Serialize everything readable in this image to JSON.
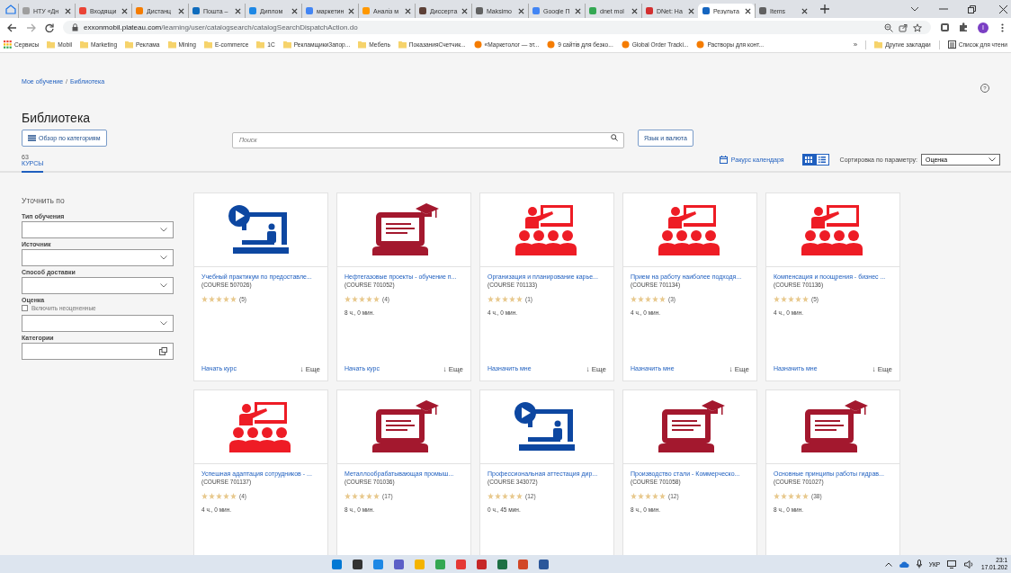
{
  "browser": {
    "tabs": [
      {
        "title": "НТУ «Дн",
        "color": "#9e9e9e",
        "selected": false
      },
      {
        "title": "Входящи",
        "color": "#ea4335",
        "selected": false
      },
      {
        "title": "Дистанц",
        "color": "#f57c00",
        "selected": false
      },
      {
        "title": "Пошта – ",
        "color": "#0f6cbd",
        "selected": false
      },
      {
        "title": "Диплом ",
        "color": "#1e88e5",
        "selected": false
      },
      {
        "title": "маркетин",
        "color": "#4285f4",
        "selected": false
      },
      {
        "title": "Аналіз м",
        "color": "#ff9800",
        "selected": false
      },
      {
        "title": "Диссерта",
        "color": "#5d4037",
        "selected": false
      },
      {
        "title": "Maksimo",
        "color": "#616161",
        "selected": false
      },
      {
        "title": "Google П",
        "color": "#4285f4",
        "selected": false
      },
      {
        "title": "dnet mol",
        "color": "#34a853",
        "selected": false
      },
      {
        "title": "DNet: На",
        "color": "#d32f2f",
        "selected": false
      },
      {
        "title": "Результа",
        "color": "#1565c0",
        "selected": true
      },
      {
        "title": "Items",
        "color": "#616161",
        "selected": false
      }
    ],
    "url_host": "exxonmobil.plateau.com",
    "url_path": "/learning/user/catalogsearch/catalogSearchDispatchAction.do",
    "profile": "I",
    "bookmarks": [
      {
        "label": "Сервисы",
        "kind": "apps"
      },
      {
        "label": "Mobil",
        "kind": "folder"
      },
      {
        "label": "Marketing",
        "kind": "folder"
      },
      {
        "label": "Реклама",
        "kind": "folder"
      },
      {
        "label": "Mining",
        "kind": "folder"
      },
      {
        "label": "E-commerce",
        "kind": "folder"
      },
      {
        "label": "1С",
        "kind": "folder"
      },
      {
        "label": "РекламщикиЗапор...",
        "kind": "folder"
      },
      {
        "label": "Мебель",
        "kind": "folder"
      },
      {
        "label": "ПоказанияСчетчик...",
        "kind": "folder"
      },
      {
        "label": "«Маркетолог — эт...",
        "kind": "site"
      },
      {
        "label": "9 сайтів для безко...",
        "kind": "site"
      },
      {
        "label": "Global Order Tracki...",
        "kind": "site"
      },
      {
        "label": "Растворы для конт...",
        "kind": "site"
      }
    ],
    "more": "»",
    "other": [
      {
        "label": "Другие закладки",
        "kind": "folder"
      },
      {
        "label": "Список для чтени",
        "kind": "list"
      }
    ]
  },
  "page": {
    "breadcrumb": [
      "Мое обучение",
      "Библиотека"
    ],
    "breadcrumb_separator": "/",
    "help": "?",
    "title": "Библиотека",
    "browse_button": "Обзор по категориям",
    "search": {
      "placeholder": "Поиск"
    },
    "language_button": "Язык и валюта",
    "tab": {
      "count": "63",
      "label": "КУРСЫ",
      "selected": true
    },
    "calendar_link": "Ракурс календаря",
    "views": [
      {
        "kind": "grid",
        "selected": true
      },
      {
        "kind": "list",
        "selected": false
      }
    ],
    "sort_label": "Сортировка по параметру:",
    "sort_value": "Оценка",
    "refine": "Уточнить по",
    "filters": [
      {
        "label": "Тип обучения",
        "kind": "select"
      },
      {
        "label": "Источник",
        "kind": "select"
      },
      {
        "label": "Способ доставки",
        "kind": "select"
      },
      {
        "label": "Оценка",
        "kind": "select",
        "checkbox": {
          "label": "Включить неоцененные",
          "checked": false
        }
      },
      {
        "label": "Категории",
        "kind": "picker"
      }
    ],
    "cards": [
      {
        "kind": "video",
        "title": "Учебный практикум по предоставле...",
        "code": "(COURSE 507026)",
        "stars": 5,
        "reviews": "(5)",
        "action": "Начать курс",
        "more": "↓ Еще"
      },
      {
        "kind": "laptop",
        "title": "Нефтегазовые проекты - обучение п...",
        "code": "(COURSE 701052)",
        "stars": 5,
        "reviews": "(4)",
        "duration": "8 ч., 0 мин.",
        "action": "Начать курс",
        "more": "↓ Еще"
      },
      {
        "kind": "teacher",
        "title": "Организация и планирование карье...",
        "code": "(COURSE 701133)",
        "stars": 5,
        "reviews": "(1)",
        "duration": "4 ч., 0 мин.",
        "action": "Назначить мне",
        "more": "↓ Еще"
      },
      {
        "kind": "teacher",
        "title": "Прием на работу наиболее подходя...",
        "code": "(COURSE 701134)",
        "stars": 5,
        "reviews": "(3)",
        "duration": "4 ч., 0 мин.",
        "action": "Назначить мне",
        "more": "↓ Еще"
      },
      {
        "kind": "teacher",
        "title": "Компенсация и поощрения - бизнес ...",
        "code": "(COURSE 701136)",
        "stars": 5,
        "reviews": "(5)",
        "duration": "4 ч., 0 мин.",
        "action": "Назначить мне",
        "more": "↓ Еще"
      },
      {
        "kind": "teacher",
        "title": "Успешная адаптация сотрудников - ...",
        "code": "(COURSE 701137)",
        "stars": 5,
        "reviews": "(4)",
        "duration": "4 ч., 0 мин."
      },
      {
        "kind": "laptop",
        "title": "Металлообрабатывающая промыш...",
        "code": "(COURSE 701036)",
        "stars": 5,
        "reviews": "(17)",
        "duration": "8 ч., 0 мин."
      },
      {
        "kind": "video",
        "title": "Профессиональная аттестация дир...",
        "code": "(COURSE 343072)",
        "stars": 5,
        "reviews": "(12)",
        "duration": "0 ч., 45 мин."
      },
      {
        "kind": "laptop",
        "title": "Производство стали - Коммерческо...",
        "code": "(COURSE 701058)",
        "stars": 5,
        "reviews": "(12)",
        "duration": "8 ч., 0 мин."
      },
      {
        "kind": "laptop",
        "title": "Основные принципы работы гидрав...",
        "code": "(COURSE 701027)",
        "stars": 5,
        "reviews": "(38)",
        "duration": "8 ч., 0 мин."
      }
    ]
  },
  "taskbar": {
    "apps": [
      {
        "color": "#0078d4"
      },
      {
        "color": "#333333"
      },
      {
        "color": "#1e88e5"
      },
      {
        "color": "#5b5fc7"
      },
      {
        "color": "#f4b400"
      },
      {
        "color": "#34a853"
      },
      {
        "color": "#e53935"
      },
      {
        "color": "#c62828"
      },
      {
        "color": "#1d7044"
      },
      {
        "color": "#d24726"
      },
      {
        "color": "#2b579a"
      }
    ],
    "language": "УКР",
    "time": "23:1",
    "date": "17.01.202"
  }
}
